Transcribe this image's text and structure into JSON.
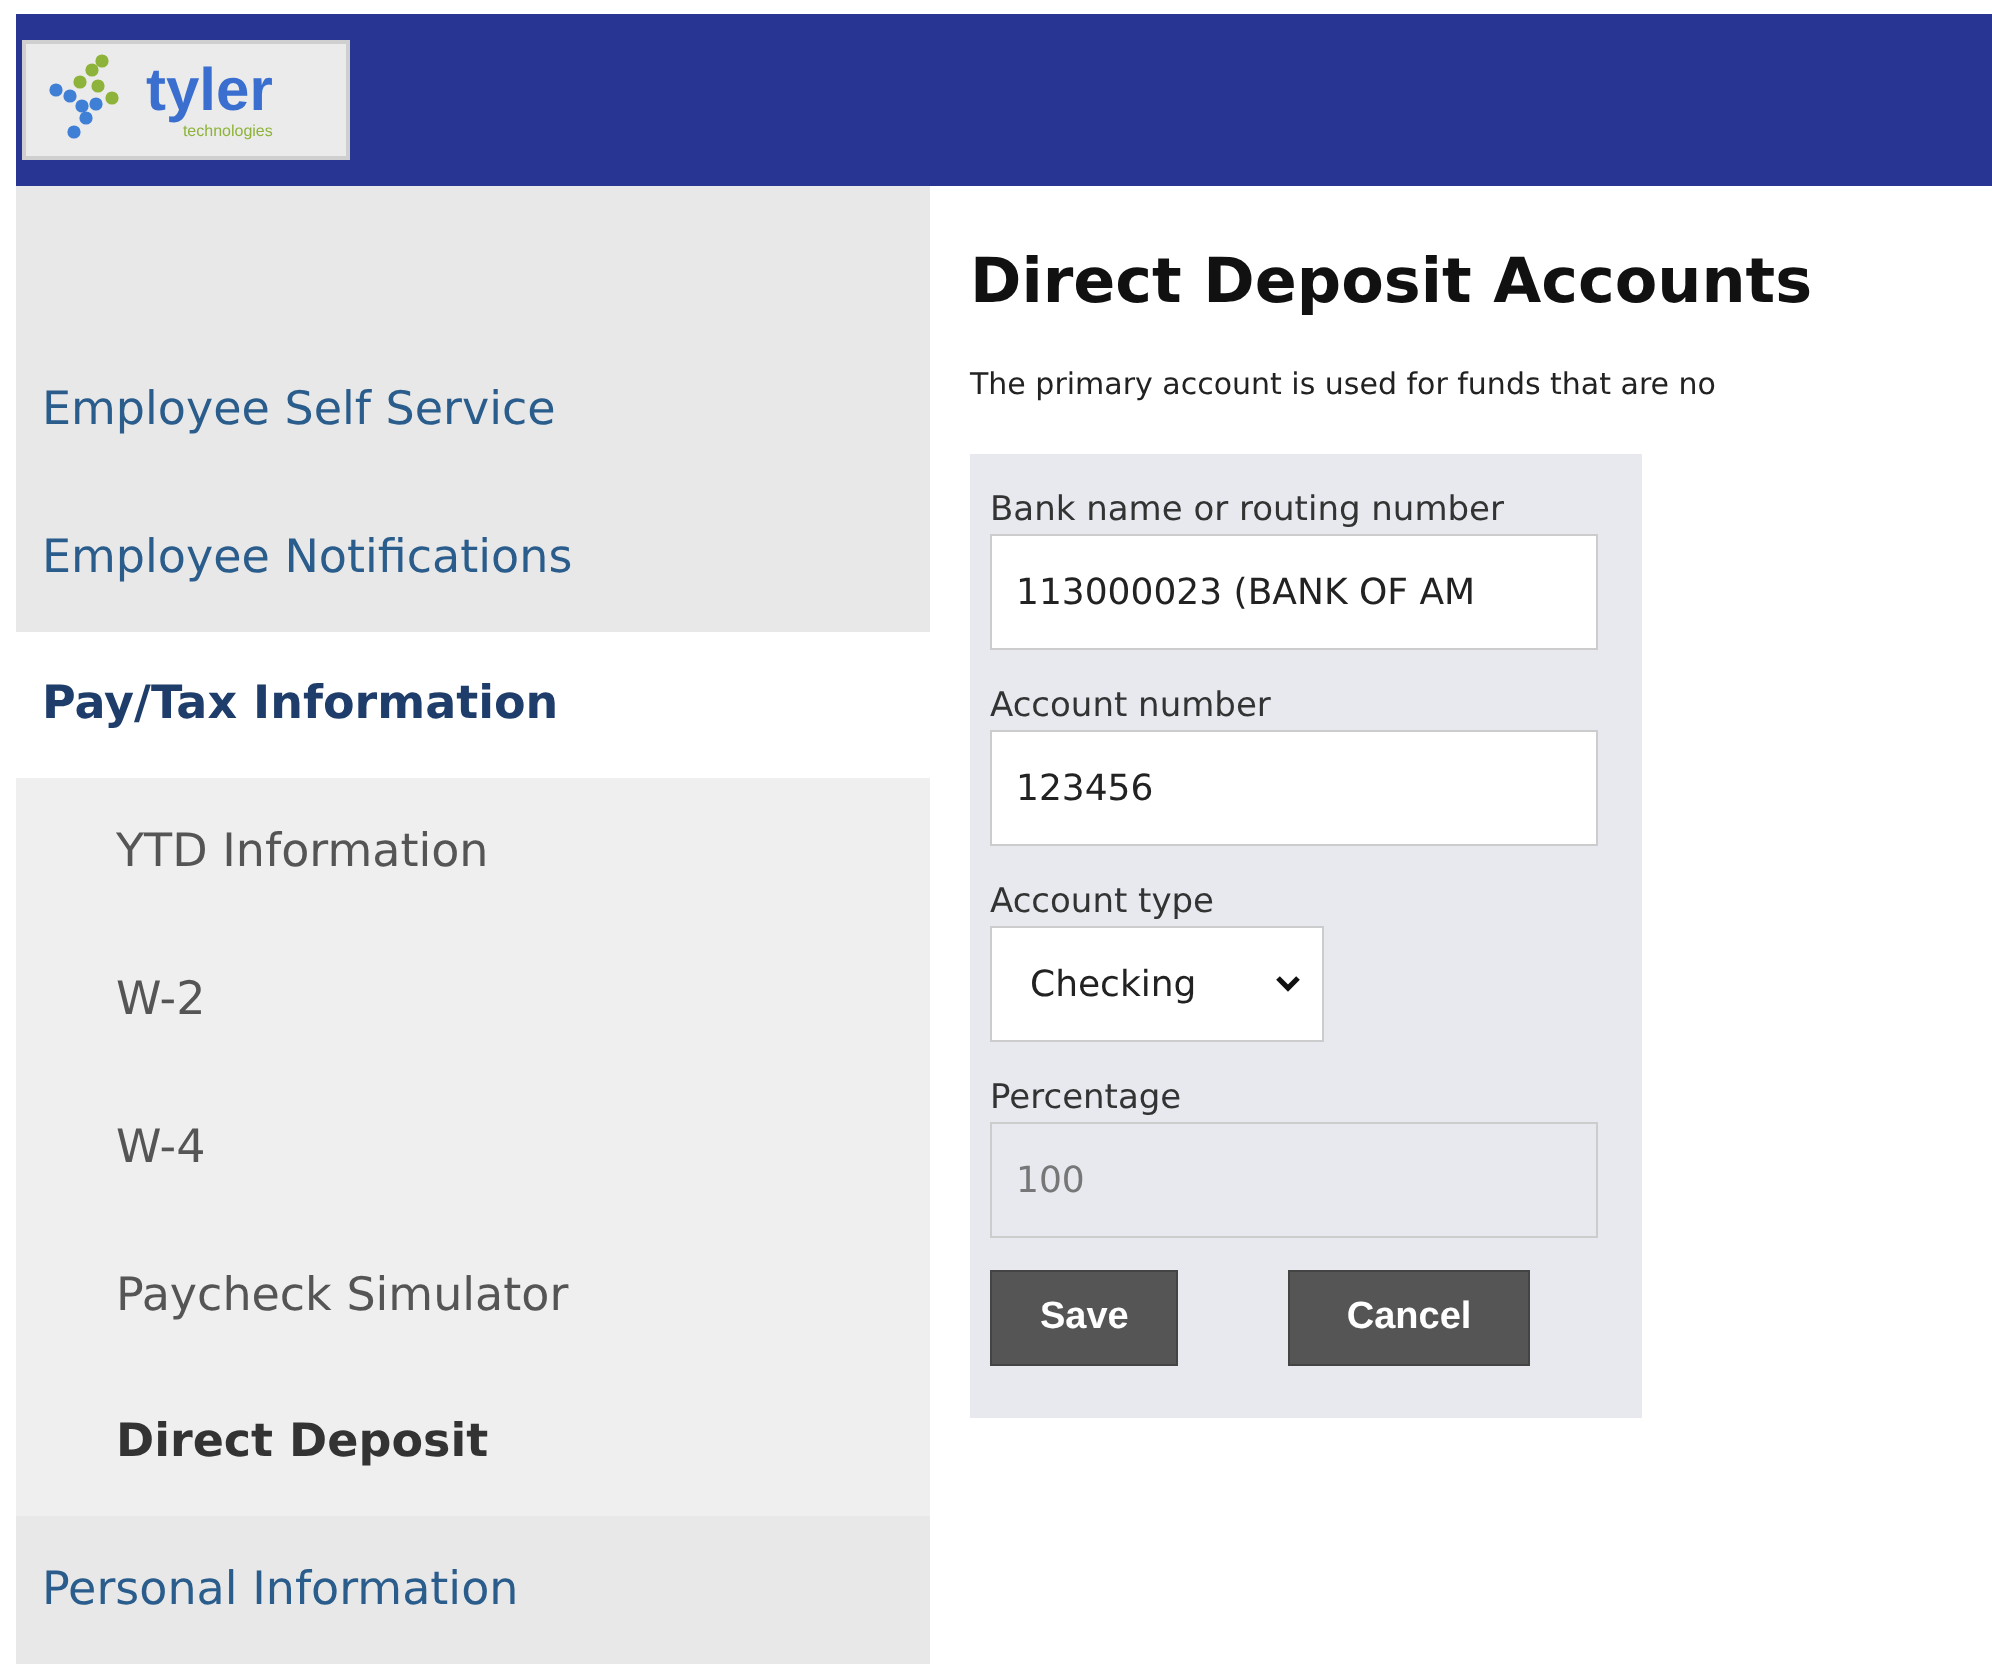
{
  "header": {
    "logo": {
      "name": "tyler",
      "tagline": "technologies"
    }
  },
  "sidebar": {
    "items": [
      {
        "label": "Employee Self Service",
        "selected": false
      },
      {
        "label": "Employee Notifications",
        "selected": false
      },
      {
        "label": "Pay/Tax Information",
        "selected": true,
        "children": [
          {
            "label": "YTD Information",
            "selected": false
          },
          {
            "label": "W-2",
            "selected": false
          },
          {
            "label": "W-4",
            "selected": false
          },
          {
            "label": "Paycheck Simulator",
            "selected": false
          },
          {
            "label": "Direct Deposit",
            "selected": true
          }
        ]
      },
      {
        "label": "Personal Information",
        "selected": false
      }
    ]
  },
  "main": {
    "title": "Direct Deposit Accounts",
    "description": "The primary account is used for funds that are no",
    "form": {
      "fields": [
        {
          "kind": "text",
          "label": "Bank name or routing number",
          "value": "113000023 (BANK OF AM",
          "disabled": false
        },
        {
          "kind": "text",
          "label": "Account number",
          "value": "123456",
          "disabled": false
        },
        {
          "kind": "select",
          "label": "Account type",
          "value": "Checking",
          "disabled": false
        },
        {
          "kind": "text",
          "label": "Percentage",
          "value": "100",
          "disabled": true
        }
      ],
      "buttons": [
        "Save",
        "Cancel"
      ]
    }
  }
}
